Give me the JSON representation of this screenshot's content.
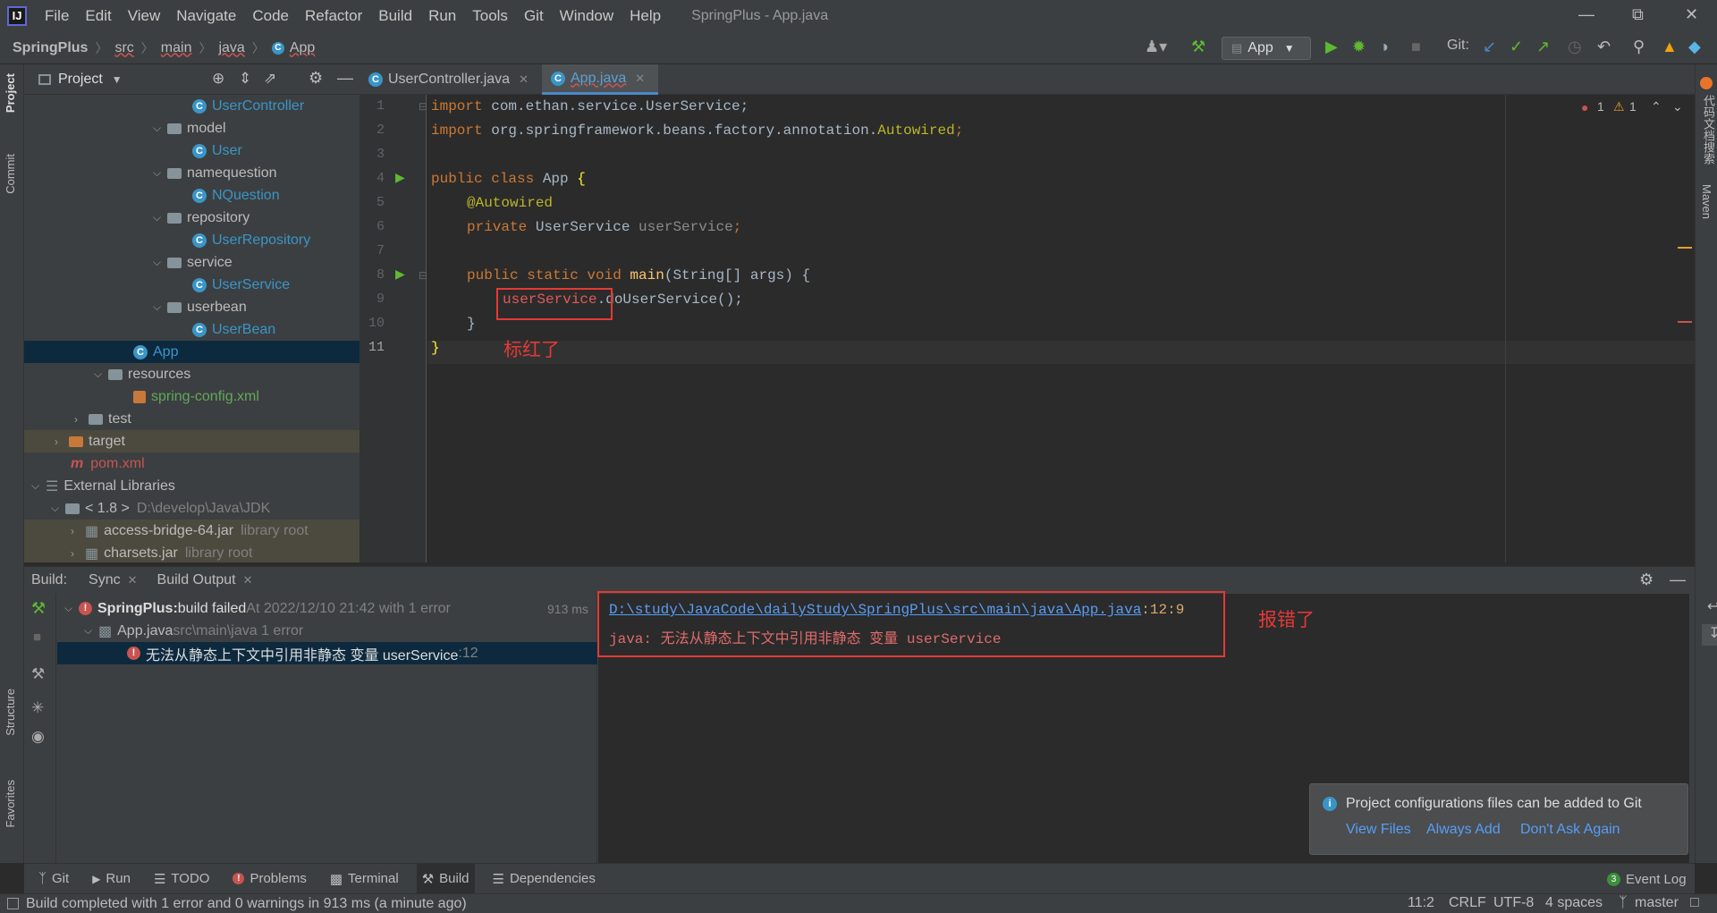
{
  "menubar": {
    "items": [
      "File",
      "Edit",
      "View",
      "Navigate",
      "Code",
      "Refactor",
      "Build",
      "Run",
      "Tools",
      "Git",
      "Window",
      "Help"
    ],
    "window_title": "SpringPlus - App.java"
  },
  "breadcrumb": [
    "SpringPlus",
    "src",
    "main",
    "java",
    "App"
  ],
  "toolbar": {
    "run_config": "App",
    "git_label": "Git:"
  },
  "project_panel": {
    "title": "Project",
    "tree": [
      {
        "label": "UserController",
        "kind": "class",
        "color": "#3a95c7"
      },
      {
        "label": "model",
        "kind": "folder"
      },
      {
        "label": "User",
        "kind": "class"
      },
      {
        "label": "namequestion",
        "kind": "folder"
      },
      {
        "label": "NQuestion",
        "kind": "class"
      },
      {
        "label": "repository",
        "kind": "folder"
      },
      {
        "label": "UserRepository",
        "kind": "class"
      },
      {
        "label": "service",
        "kind": "folder"
      },
      {
        "label": "UserService",
        "kind": "class"
      },
      {
        "label": "userbean",
        "kind": "folder"
      },
      {
        "label": "UserBean",
        "kind": "class"
      },
      {
        "label": "App",
        "kind": "class"
      },
      {
        "label": "resources",
        "kind": "folder"
      },
      {
        "label": "spring-config.xml",
        "kind": "xml"
      },
      {
        "label": "test",
        "kind": "folder"
      },
      {
        "label": "target",
        "kind": "folder"
      },
      {
        "label": "pom.xml",
        "kind": "maven"
      },
      {
        "label": "External Libraries",
        "kind": "lib"
      },
      {
        "label": "< 1.8 >",
        "hint": "D:\\develop\\Java\\JDK",
        "kind": "jdk"
      },
      {
        "label": "access-bridge-64.jar",
        "hint": "library root",
        "kind": "jar"
      },
      {
        "label": "charsets.jar",
        "hint": "library root",
        "kind": "jar"
      }
    ]
  },
  "editor": {
    "tabs": [
      {
        "label": "UserController.java"
      },
      {
        "label": "App.java"
      }
    ],
    "line_numbers": [
      "1",
      "2",
      "3",
      "4",
      "5",
      "6",
      "7",
      "8",
      "9",
      "10",
      "11"
    ],
    "code": {
      "l1_kw": "import",
      "l1_rest": " com.ethan.service.UserService;",
      "l2_kw": "import",
      "l2_rest": " org.springframework.beans.factory.annotation.",
      "l2_ann": "Autowired",
      "l2_end": ";",
      "l4_kw": "public class",
      "l4_name": " App ",
      "l4_brace": "{",
      "l5_ann": "@Autowired",
      "l6_kw": "private",
      "l6_type": " UserService ",
      "l6_field": "userService",
      "l6_end": ";",
      "l8_kw": "public static void",
      "l8_fn": " main",
      "l8_rest": "(String[] args) {",
      "l9_field": "userService",
      "l9_rest": ".doUserService();",
      "l10": "}",
      "l11": "}"
    },
    "inspection": {
      "errors": "1",
      "warnings": "1"
    },
    "annotation_label": "标红了"
  },
  "build_panel": {
    "label": "Build:",
    "tabs": [
      {
        "label": "Sync"
      },
      {
        "label": "Build Output"
      }
    ],
    "tree": {
      "root_name": "SpringPlus:",
      "root_status": " build failed",
      "root_time": " At 2022/12/10 21:42 with 1 error",
      "root_duration": "913 ms",
      "file": "App.java",
      "file_path": " src\\main\\java 1 error",
      "error_msg": "无法从静态上下文中引用非静态 变量 userService",
      "error_line": " :12"
    },
    "output": {
      "path": "D:\\study\\JavaCode\\dailyStudy\\SpringPlus\\src\\main\\java\\App.java",
      "pos": ":12:9",
      "message": "java: 无法从静态上下文中引用非静态 变量 userService"
    },
    "annotation_label": "报错了"
  },
  "notification": {
    "text": "Project configurations files can be added to Git",
    "actions": [
      "View Files",
      "Always Add",
      "Don't Ask Again"
    ]
  },
  "bottom_tabs": [
    "Git",
    "Run",
    "TODO",
    "Problems",
    "Terminal",
    "Build",
    "Dependencies"
  ],
  "event_log": {
    "count": "3",
    "label": "Event Log"
  },
  "side_tabs": {
    "project": "Project",
    "commit": "Commit",
    "structure": "Structure",
    "favorites": "Favorites",
    "right_top": "代码文档搜索",
    "maven": "Maven"
  },
  "status": {
    "message": "Build completed with 1 error and 0 warnings in 913 ms (a minute ago)",
    "position": "11:2",
    "line_sep": "CRLF",
    "encoding": "UTF-8",
    "indent": "4 spaces",
    "branch": "master"
  }
}
